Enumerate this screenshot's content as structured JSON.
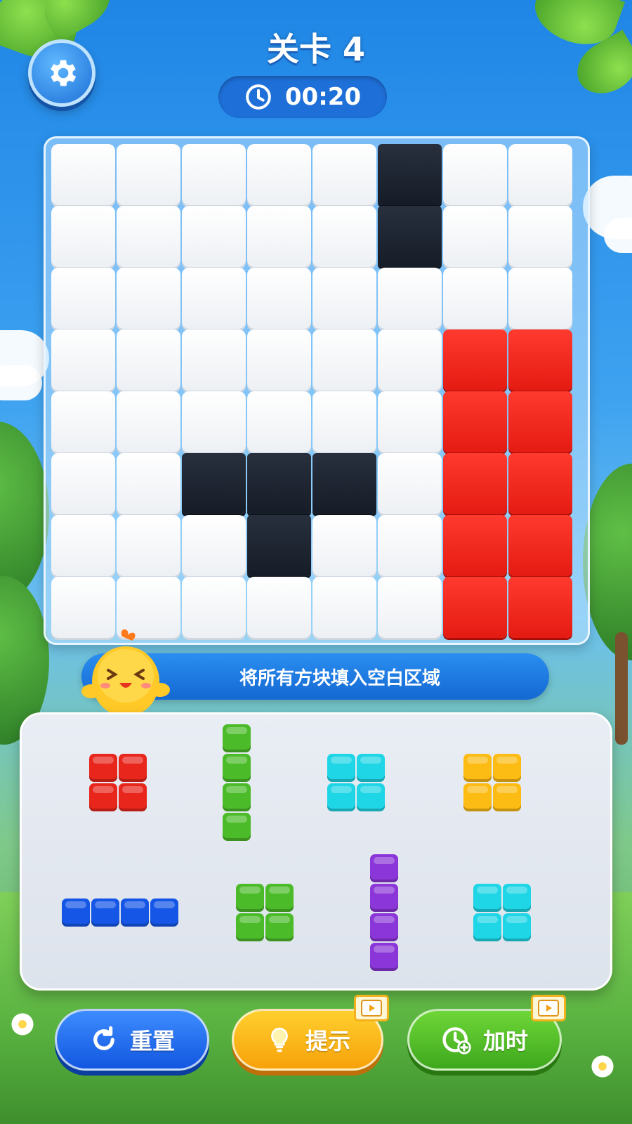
{
  "header": {
    "level_title": "关卡 4",
    "timer": "00:20"
  },
  "board": {
    "rows": 8,
    "cols": 8,
    "filled": [
      {
        "row": 0,
        "col": 5,
        "color": "black"
      },
      {
        "row": 1,
        "col": 5,
        "color": "black"
      },
      {
        "row": 3,
        "col": 6,
        "color": "red"
      },
      {
        "row": 3,
        "col": 7,
        "color": "red"
      },
      {
        "row": 4,
        "col": 6,
        "color": "red"
      },
      {
        "row": 4,
        "col": 7,
        "color": "red"
      },
      {
        "row": 5,
        "col": 2,
        "color": "black"
      },
      {
        "row": 5,
        "col": 3,
        "color": "black"
      },
      {
        "row": 5,
        "col": 4,
        "color": "black"
      },
      {
        "row": 5,
        "col": 6,
        "color": "red"
      },
      {
        "row": 5,
        "col": 7,
        "color": "red"
      },
      {
        "row": 6,
        "col": 3,
        "color": "black"
      },
      {
        "row": 6,
        "col": 6,
        "color": "red"
      },
      {
        "row": 6,
        "col": 7,
        "color": "red"
      },
      {
        "row": 7,
        "col": 6,
        "color": "red"
      },
      {
        "row": 7,
        "col": 7,
        "color": "red"
      }
    ]
  },
  "hint_banner": {
    "text": "将所有方块填入空白区域"
  },
  "tray": {
    "pieces": [
      {
        "name": "red-square-piece",
        "color": "#e8261c",
        "shape": [
          [
            1,
            1
          ],
          [
            1,
            1
          ]
        ]
      },
      {
        "name": "green-vertical-piece",
        "color": "#4cbb2a",
        "shape": [
          [
            1
          ],
          [
            1
          ],
          [
            1
          ],
          [
            1
          ]
        ]
      },
      {
        "name": "cyan-square-piece",
        "color": "#1fd6e6",
        "shape": [
          [
            1,
            1
          ],
          [
            1,
            1
          ]
        ]
      },
      {
        "name": "yellow-square-piece",
        "color": "#fcbc14",
        "shape": [
          [
            1,
            1
          ],
          [
            1,
            1
          ]
        ]
      },
      {
        "name": "blue-horizontal-piece",
        "color": "#1556e6",
        "shape": [
          [
            1,
            1,
            1,
            1
          ]
        ]
      },
      {
        "name": "green-square-piece",
        "color": "#4cbb2a",
        "shape": [
          [
            1,
            1
          ],
          [
            1,
            1
          ]
        ]
      },
      {
        "name": "purple-vertical-piece",
        "color": "#8b36d8",
        "shape": [
          [
            1
          ],
          [
            1
          ],
          [
            1
          ],
          [
            1
          ]
        ]
      },
      {
        "name": "cyan-square-piece-2",
        "color": "#1fd6e6",
        "shape": [
          [
            1,
            1
          ],
          [
            1,
            1
          ]
        ]
      }
    ]
  },
  "buttons": {
    "reset_label": "重置",
    "hint_label": "提示",
    "add_time_label": "加时"
  },
  "colors": {
    "black": "#1a202c",
    "red": "#e8261c",
    "accent_blue": "#1e6fd8"
  },
  "icons": {
    "settings": "gear-icon",
    "timer": "clock-icon",
    "reset": "refresh-icon",
    "hint": "lightbulb-icon",
    "add_time": "clock-plus-icon",
    "video": "video-icon"
  }
}
